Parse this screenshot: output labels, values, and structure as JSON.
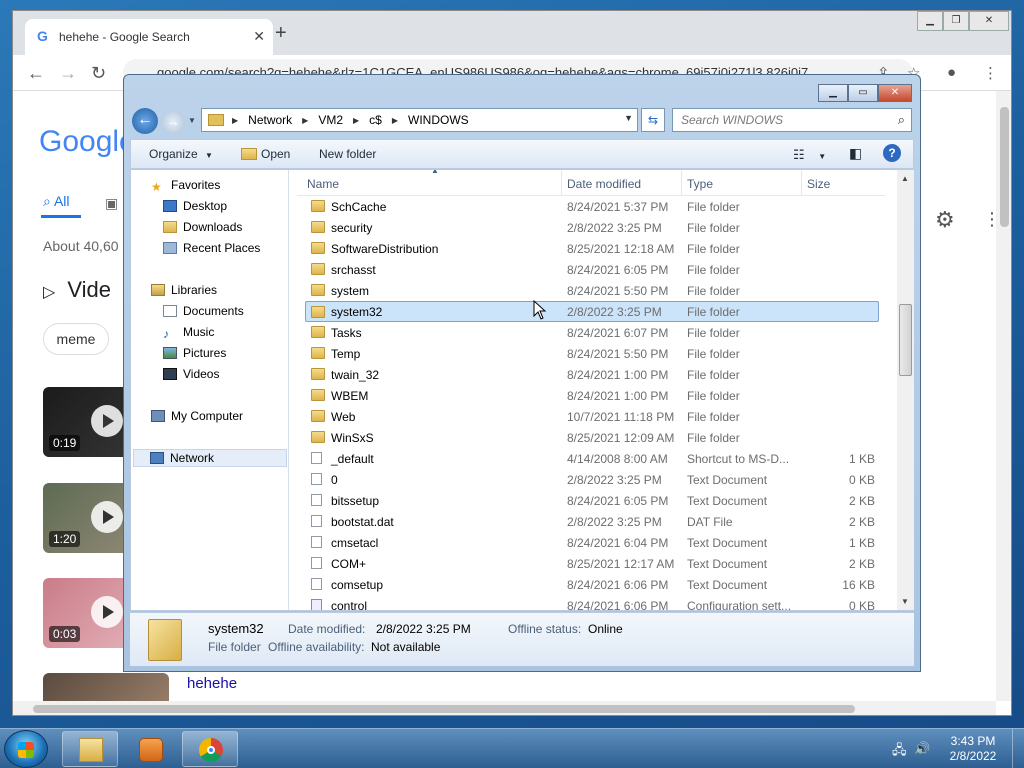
{
  "chrome": {
    "tab_title": "hehehe - Google Search",
    "url": "google.com/search?q=hehehe&rlz=1C1GCEA_enUS986US986&oq=hehehe&aqs=chrome..69i57j0i271l3.826j0j7",
    "logo": "Google",
    "search_tabs": {
      "all": "All"
    },
    "results_about": "About 40,60",
    "videos_heading": "Vide",
    "chip_meme": "meme",
    "videos": [
      {
        "duration": "0:19"
      },
      {
        "duration": "1:20"
      },
      {
        "duration": "0:03"
      }
    ],
    "link_text": "hehehe"
  },
  "explorer": {
    "address": [
      "Network",
      "VM2",
      "c$",
      "WINDOWS"
    ],
    "search_placeholder": "Search WINDOWS",
    "toolbar": {
      "organize": "Organize",
      "open": "Open",
      "new_folder": "New folder"
    },
    "nav": {
      "favorites": "Favorites",
      "desktop": "Desktop",
      "downloads": "Downloads",
      "recent": "Recent Places",
      "libraries": "Libraries",
      "documents": "Documents",
      "music": "Music",
      "pictures": "Pictures",
      "videos": "Videos",
      "computer": "My Computer",
      "network": "Network"
    },
    "columns": {
      "name": "Name",
      "date": "Date modified",
      "type": "Type",
      "size": "Size"
    },
    "files": [
      {
        "name": "SchCache",
        "date": "8/24/2021 5:37 PM",
        "type": "File folder",
        "size": "",
        "icon": "folder"
      },
      {
        "name": "security",
        "date": "2/8/2022 3:25 PM",
        "type": "File folder",
        "size": "",
        "icon": "folder"
      },
      {
        "name": "SoftwareDistribution",
        "date": "8/25/2021 12:18 AM",
        "type": "File folder",
        "size": "",
        "icon": "folder"
      },
      {
        "name": "srchasst",
        "date": "8/24/2021 6:05 PM",
        "type": "File folder",
        "size": "",
        "icon": "folder"
      },
      {
        "name": "system",
        "date": "8/24/2021 5:50 PM",
        "type": "File folder",
        "size": "",
        "icon": "folder"
      },
      {
        "name": "system32",
        "date": "2/8/2022 3:25 PM",
        "type": "File folder",
        "size": "",
        "icon": "folder"
      },
      {
        "name": "Tasks",
        "date": "8/24/2021 6:07 PM",
        "type": "File folder",
        "size": "",
        "icon": "folder"
      },
      {
        "name": "Temp",
        "date": "8/24/2021 5:50 PM",
        "type": "File folder",
        "size": "",
        "icon": "folder"
      },
      {
        "name": "twain_32",
        "date": "8/24/2021 1:00 PM",
        "type": "File folder",
        "size": "",
        "icon": "folder"
      },
      {
        "name": "WBEM",
        "date": "8/24/2021 1:00 PM",
        "type": "File folder",
        "size": "",
        "icon": "folder"
      },
      {
        "name": "Web",
        "date": "10/7/2021 11:18 PM",
        "type": "File folder",
        "size": "",
        "icon": "folder"
      },
      {
        "name": "WinSxS",
        "date": "8/25/2021 12:09 AM",
        "type": "File folder",
        "size": "",
        "icon": "folder"
      },
      {
        "name": "_default",
        "date": "4/14/2008 8:00 AM",
        "type": "Shortcut to MS-D...",
        "size": "1 KB",
        "icon": "doc"
      },
      {
        "name": "0",
        "date": "2/8/2022 3:25 PM",
        "type": "Text Document",
        "size": "0 KB",
        "icon": "doc"
      },
      {
        "name": "bitssetup",
        "date": "8/24/2021 6:05 PM",
        "type": "Text Document",
        "size": "2 KB",
        "icon": "doc"
      },
      {
        "name": "bootstat.dat",
        "date": "2/8/2022 3:25 PM",
        "type": "DAT File",
        "size": "2 KB",
        "icon": "doc"
      },
      {
        "name": "cmsetacl",
        "date": "8/24/2021 6:04 PM",
        "type": "Text Document",
        "size": "1 KB",
        "icon": "doc"
      },
      {
        "name": "COM+",
        "date": "8/25/2021 12:17 AM",
        "type": "Text Document",
        "size": "2 KB",
        "icon": "doc"
      },
      {
        "name": "comsetup",
        "date": "8/24/2021 6:06 PM",
        "type": "Text Document",
        "size": "16 KB",
        "icon": "doc"
      },
      {
        "name": "control",
        "date": "8/24/2021 6:06 PM",
        "type": "Configuration sett...",
        "size": "0 KB",
        "icon": "cfg"
      }
    ],
    "selected_index": 5,
    "details": {
      "name": "system32",
      "date_label": "Date modified:",
      "date_value": "2/8/2022 3:25 PM",
      "status_label": "Offline status:",
      "status_value": "Online",
      "type": "File folder",
      "avail_label": "Offline availability:",
      "avail_value": "Not available"
    }
  },
  "taskbar": {
    "time": "3:43 PM",
    "date": "2/8/2022"
  }
}
